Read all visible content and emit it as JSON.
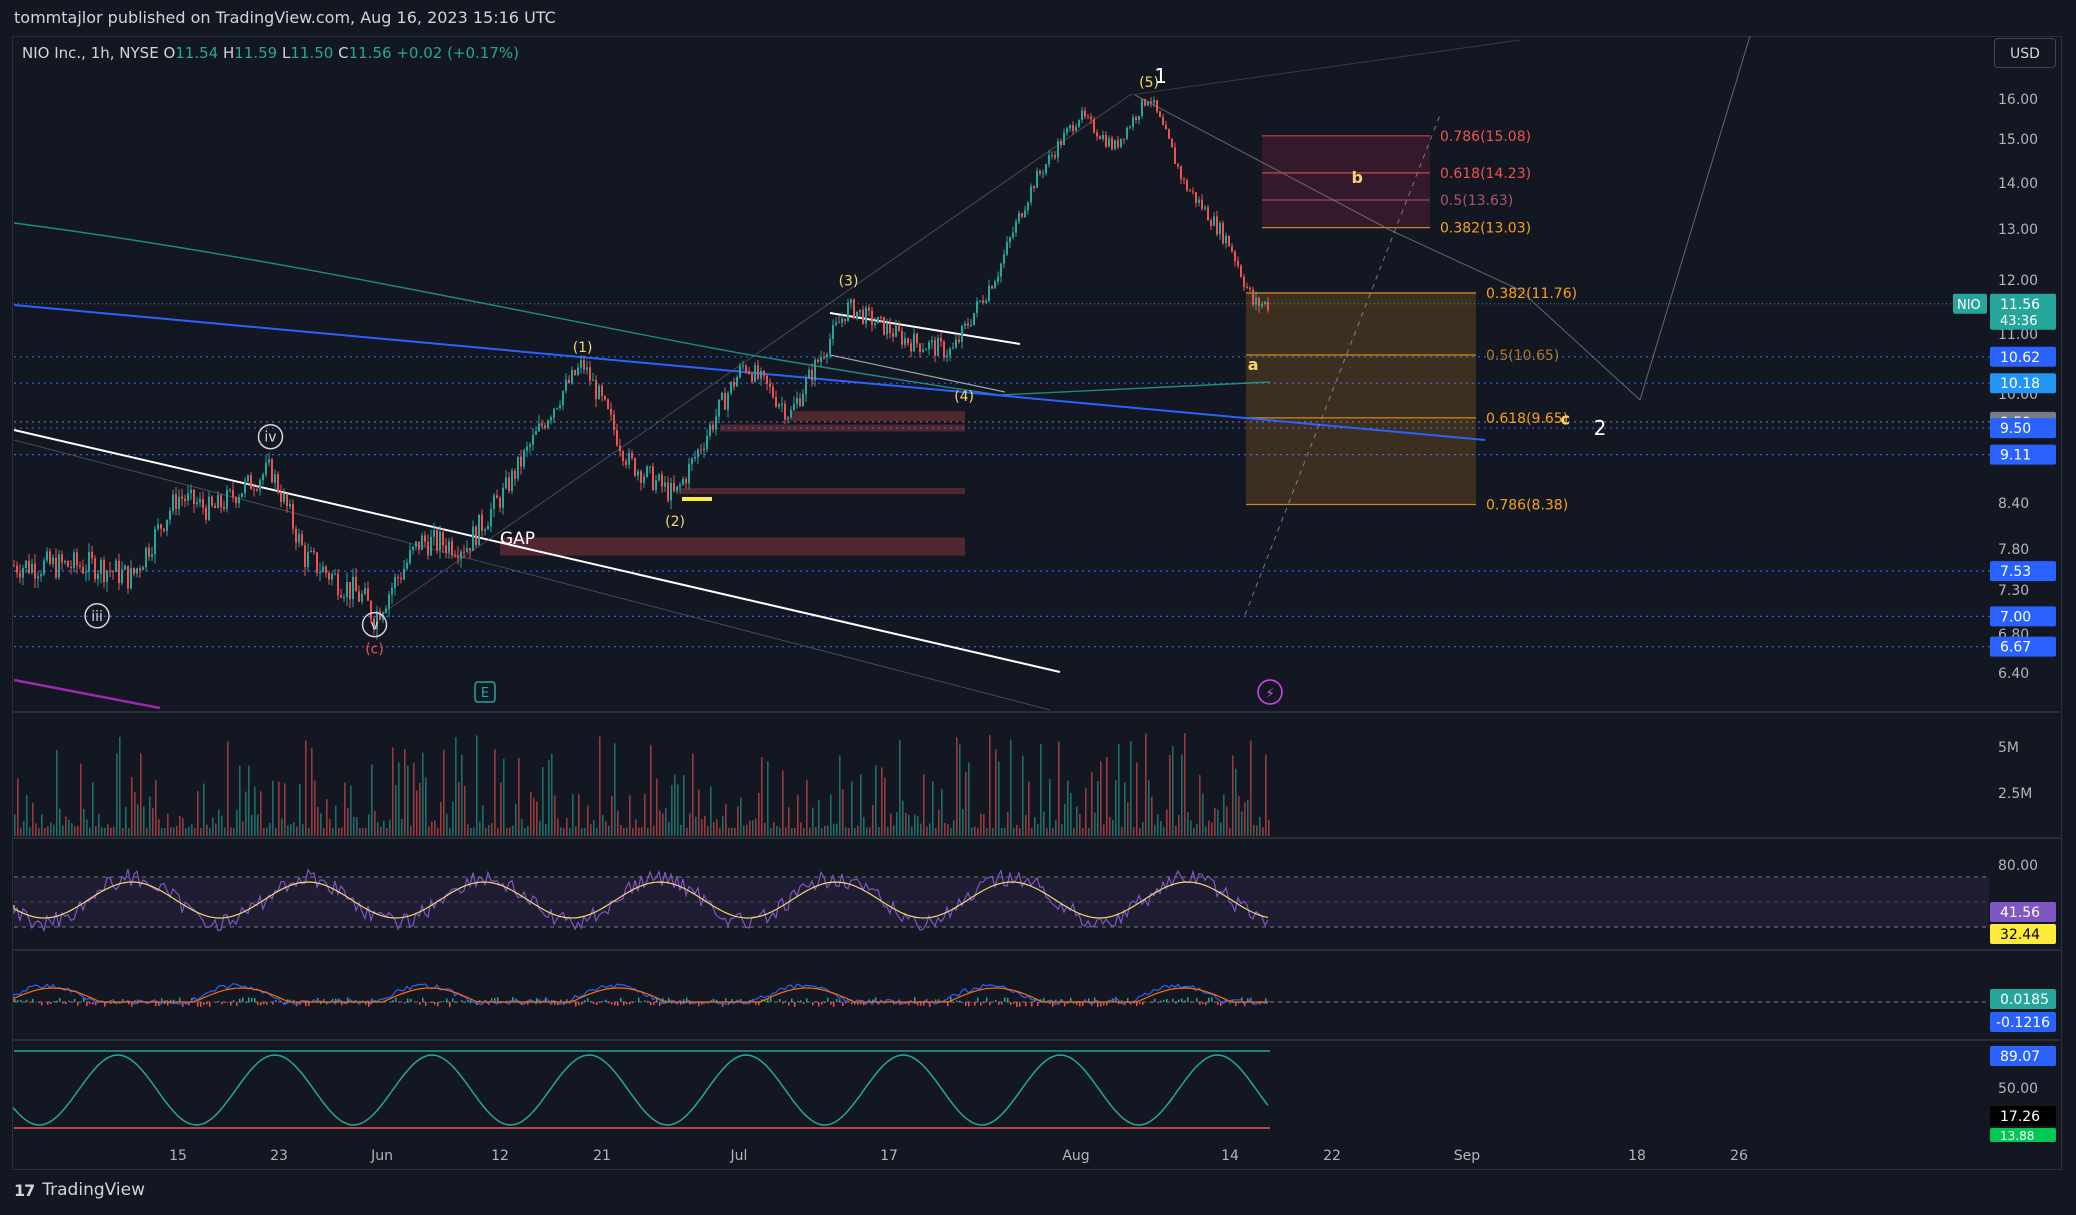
{
  "header": {
    "publisher": "tommtajlor published on TradingView.com, Aug 16, 2023 15:16 UTC"
  },
  "legend": {
    "symbol": "NIO Inc., 1h, NYSE",
    "o_label": "O",
    "o": "11.54",
    "h_label": "H",
    "h": "11.59",
    "l_label": "L",
    "l": "11.50",
    "c_label": "C",
    "c": "11.56",
    "change": "+0.02 (+0.17%)"
  },
  "currency": "USD",
  "footer": {
    "brand": "TradingView",
    "logo": "17"
  },
  "colors": {
    "bg": "#131722",
    "up": "#26a69a",
    "down": "#ef5350",
    "fib": "#f7a21b",
    "rsi": "#7e57c2",
    "blue": "#2962ff",
    "white": "#ffffff"
  },
  "chart_data": {
    "type": "candlestick",
    "symbol": "NIO",
    "interval": "1h",
    "ylim": [
      6.2,
      16.6
    ],
    "y_axis_ticks": [
      "16.00",
      "15.00",
      "14.00",
      "13.00",
      "12.00",
      "11.00",
      "10.00",
      "8.40",
      "7.80",
      "7.30",
      "6.80",
      "6.40"
    ],
    "x_axis_ticks": [
      "15",
      "23",
      "Jun",
      "12",
      "21",
      "Jul",
      "17",
      "Aug",
      "14",
      "22",
      "Sep",
      "18",
      "26"
    ],
    "price_path": [
      {
        "date": "May 8",
        "close": 7.6
      },
      {
        "date": "May 11",
        "close": 7.45
      },
      {
        "date": "May 15",
        "close": 8.5
      },
      {
        "date": "May 18",
        "close": 8.3
      },
      {
        "date": "May 23",
        "close": 8.9
      },
      {
        "date": "May 26",
        "close": 7.7
      },
      {
        "date": "May 31",
        "close": 7.2
      },
      {
        "date": "Jun 1",
        "close": 7.0
      },
      {
        "date": "Jun 5",
        "close": 7.9
      },
      {
        "date": "Jun 9",
        "close": 7.85
      },
      {
        "date": "Jun 12",
        "close": 8.5
      },
      {
        "date": "Jun 16",
        "close": 9.7
      },
      {
        "date": "Jun 19",
        "close": 10.5
      },
      {
        "date": "Jun 23",
        "close": 9.0
      },
      {
        "date": "Jun 27",
        "close": 8.5
      },
      {
        "date": "Jul 3",
        "close": 10.5
      },
      {
        "date": "Jul 7",
        "close": 9.7
      },
      {
        "date": "Jul 12",
        "close": 11.5
      },
      {
        "date": "Jul 17",
        "close": 10.9
      },
      {
        "date": "Jul 21",
        "close": 10.7
      },
      {
        "date": "Jul 25",
        "close": 12.2
      },
      {
        "date": "Jul 28",
        "close": 14.0
      },
      {
        "date": "Aug 1",
        "close": 15.6
      },
      {
        "date": "Aug 4",
        "close": 14.8
      },
      {
        "date": "Aug 7",
        "close": 16.1
      },
      {
        "date": "Aug 10",
        "close": 14.0
      },
      {
        "date": "Aug 14",
        "close": 12.7
      },
      {
        "date": "Aug 16",
        "close": 11.56
      }
    ],
    "last_price": {
      "label": "NIO",
      "value": "11.56",
      "countdown": "43:36"
    },
    "price_labels": [
      {
        "value": "10.62",
        "color": "#2962ff"
      },
      {
        "value": "10.18",
        "color": "#2196f3"
      },
      {
        "value": "9.59",
        "color": "#787b86"
      },
      {
        "value": "9.50",
        "color": "#2962ff"
      },
      {
        "value": "9.11",
        "color": "#2962ff"
      },
      {
        "value": "7.53",
        "color": "#2962ff"
      },
      {
        "value": "7.00",
        "color": "#2962ff"
      },
      {
        "value": "6.67",
        "color": "#2962ff"
      }
    ],
    "fib_retracement_down": [
      {
        "label": "0.382(11.76)",
        "price": 11.76
      },
      {
        "label": "0.5(10.65)",
        "price": 10.65
      },
      {
        "label": "0.618(9.65)",
        "price": 9.65
      },
      {
        "label": "0.786(8.38)",
        "price": 8.38
      }
    ],
    "fib_retracement_up": [
      {
        "label": "0.786(15.08)",
        "price": 15.08
      },
      {
        "label": "0.618(14.23)",
        "price": 14.23
      },
      {
        "label": "0.5(13.63)",
        "price": 13.63
      },
      {
        "label": "0.382(13.03)",
        "price": 13.03
      }
    ],
    "wave_labels": [
      {
        "text": "(1)",
        "date": "Jun 19",
        "price": 10.7
      },
      {
        "text": "(2)",
        "date": "Jun 27",
        "price": 8.1
      },
      {
        "text": "(3)",
        "date": "Jul 12",
        "price": 11.9
      },
      {
        "text": "(4)",
        "date": "Jul 22",
        "price": 9.9
      },
      {
        "text": "(5)",
        "date": "Aug 7",
        "price": 16.3
      },
      {
        "text": "1",
        "date": "Aug 8",
        "price": 16.4
      },
      {
        "text": "a",
        "date": "Aug 16",
        "price": 10.4
      },
      {
        "text": "b",
        "date": "Aug 25",
        "price": 14.0
      },
      {
        "text": "c",
        "date": "Sep 12",
        "price": 9.55
      },
      {
        "text": "2",
        "date": "Sep 15",
        "price": 9.4
      },
      {
        "text": "iv",
        "date": "May 23",
        "price": 9.3
      },
      {
        "text": "iii",
        "date": "May 8",
        "price": 6.95
      },
      {
        "text": "v",
        "date": "Jun 1",
        "price": 6.85
      },
      {
        "text": "(c)",
        "date": "Jun 1",
        "price": 6.6
      }
    ],
    "annotations": [
      "GAP"
    ],
    "event_icons": [
      "E",
      "lightning"
    ],
    "volume": {
      "axis_ticks": [
        "5M",
        "2.5M"
      ]
    },
    "rsi": {
      "axis_ticks": [
        "80.00"
      ],
      "value": "41.56",
      "signal": "32.44"
    },
    "macd": {
      "values": [
        "0.0185",
        "-0.1216"
      ]
    },
    "stoch": {
      "axis_ticks": [
        "50.00"
      ],
      "values": [
        "89.07",
        "17.26",
        "13.88"
      ]
    }
  }
}
